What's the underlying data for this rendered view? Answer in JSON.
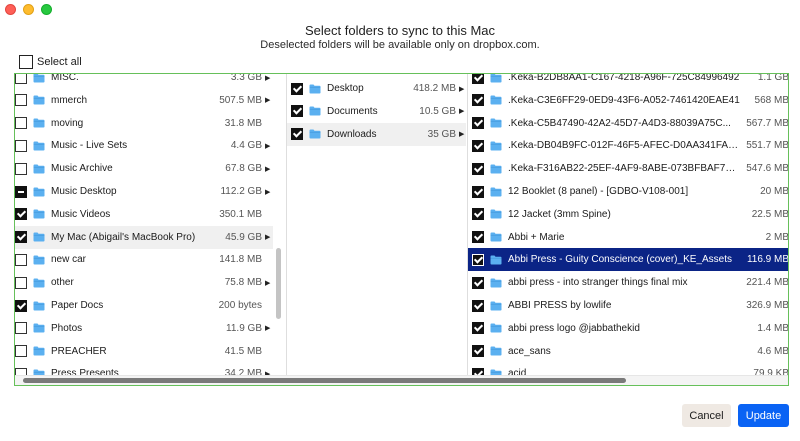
{
  "dialog": {
    "title": "Select folders to sync to this Mac",
    "subtitle": "Deselected folders will be available only on dropbox.com.",
    "select_all_label": "Select all"
  },
  "col1": [
    {
      "name": "MISC.",
      "size": "3.3 GB",
      "state": "unchecked",
      "chev": true
    },
    {
      "name": "mmerch",
      "size": "507.5 MB",
      "state": "unchecked",
      "chev": true
    },
    {
      "name": "moving",
      "size": "31.8 MB",
      "state": "unchecked",
      "chev": false
    },
    {
      "name": "Music - Live Sets",
      "size": "4.4 GB",
      "state": "unchecked",
      "chev": true
    },
    {
      "name": "Music Archive",
      "size": "67.8 GB",
      "state": "unchecked",
      "chev": true
    },
    {
      "name": "Music Desktop",
      "size": "112.2 GB",
      "state": "mixed",
      "chev": true
    },
    {
      "name": "Music Videos",
      "size": "350.1 MB",
      "state": "checked",
      "chev": false
    },
    {
      "name": "My Mac (Abigail's MacBook Pro)",
      "size": "45.9 GB",
      "state": "checked",
      "chev": true,
      "hl": true
    },
    {
      "name": "new car",
      "size": "141.8 MB",
      "state": "unchecked",
      "chev": false
    },
    {
      "name": "other",
      "size": "75.8 MB",
      "state": "unchecked",
      "chev": true
    },
    {
      "name": "Paper Docs",
      "size": "200 bytes",
      "state": "checked",
      "chev": false
    },
    {
      "name": "Photos",
      "size": "11.9 GB",
      "state": "unchecked",
      "chev": true
    },
    {
      "name": "PREACHER",
      "size": "41.5 MB",
      "state": "unchecked",
      "chev": false
    },
    {
      "name": "Press Presents",
      "size": "34.2 MB",
      "state": "unchecked",
      "chev": true
    }
  ],
  "col2": [
    {
      "name": "Desktop",
      "size": "418.2 MB",
      "state": "checked",
      "chev": true
    },
    {
      "name": "Documents",
      "size": "10.5 GB",
      "state": "checked",
      "chev": true
    },
    {
      "name": "Downloads",
      "size": "35 GB",
      "state": "checked",
      "chev": true,
      "hl": true
    }
  ],
  "col3": [
    {
      "name": ".Keka-B2DB8AA1-C167-4218-A96F-725C84996492",
      "size": "1.1 GB",
      "state": "checked"
    },
    {
      "name": ".Keka-C3E6FF29-0ED9-43F6-A052-7461420EAE41",
      "size": "568 MB",
      "state": "checked"
    },
    {
      "name": ".Keka-C5B47490-42A2-45D7-A4D3-88039A75C...",
      "size": "567.7 MB",
      "state": "checked"
    },
    {
      "name": ".Keka-DB04B9FC-012F-46F5-AFEC-D0AA341FA7...",
      "size": "551.7 MB",
      "state": "checked"
    },
    {
      "name": ".Keka-F316AB22-25EF-4AF9-8ABE-073BFBAF73AC",
      "size": "547.6 MB",
      "state": "checked"
    },
    {
      "name": "12 Booklet (8 panel) - [GDBO-V108-001]",
      "size": "20 MB",
      "state": "checked"
    },
    {
      "name": "12 Jacket (3mm Spine)",
      "size": "22.5 MB",
      "state": "checked"
    },
    {
      "name": "Abbi + Marie",
      "size": "2 MB",
      "state": "checked"
    },
    {
      "name": "Abbi Press - Guity Conscience (cover)_KE_Assets",
      "size": "116.9 MB",
      "state": "checked",
      "sel": true
    },
    {
      "name": "abbi press - into stranger things final mix",
      "size": "221.4 MB",
      "state": "checked"
    },
    {
      "name": "ABBI PRESS by lowlife",
      "size": "326.9 MB",
      "state": "checked"
    },
    {
      "name": "abbi press logo @jabbathekid",
      "size": "1.4 MB",
      "state": "checked"
    },
    {
      "name": "ace_sans",
      "size": "4.6 MB",
      "state": "checked"
    },
    {
      "name": "acid",
      "size": "79.9 KB",
      "state": "checked"
    }
  ],
  "buttons": {
    "cancel": "Cancel",
    "update": "Update"
  },
  "colors": {
    "folder": "#5bb0f0",
    "selected": "#0b2486",
    "primary": "#0a63f4",
    "border": "#66c05a"
  },
  "icons": {
    "folder": "folder-icon",
    "chevron": "chevron-right-icon"
  }
}
